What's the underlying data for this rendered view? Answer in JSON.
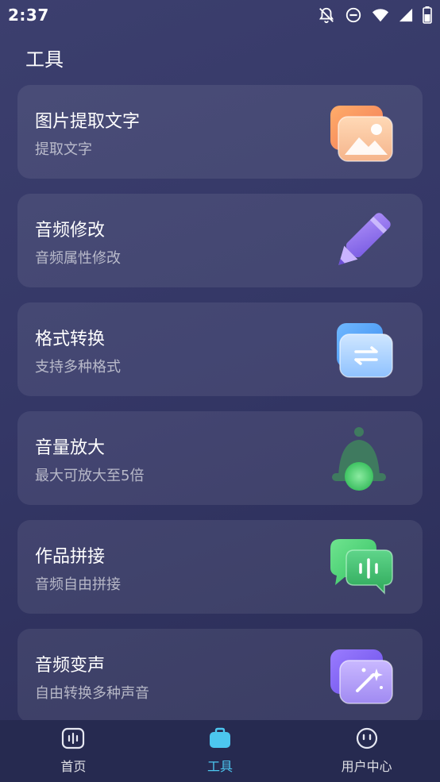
{
  "status_bar": {
    "time": "2:37",
    "icons": [
      "notifications-off-icon",
      "do-not-disturb-icon",
      "wifi-icon",
      "cellular-signal-icon",
      "battery-icon"
    ]
  },
  "page": {
    "title": "工具"
  },
  "tools": [
    {
      "title": "图片提取文字",
      "subtitle": "提取文字",
      "icon": "image-icon"
    },
    {
      "title": "音频修改",
      "subtitle": "音频属性修改",
      "icon": "pen-icon"
    },
    {
      "title": "格式转换",
      "subtitle": "支持多种格式",
      "icon": "swap-icon"
    },
    {
      "title": "音量放大",
      "subtitle": "最大可放大至5倍",
      "icon": "bell-icon"
    },
    {
      "title": "作品拼接",
      "subtitle": "音频自由拼接",
      "icon": "chat-bubbles-icon"
    },
    {
      "title": "音频变声",
      "subtitle": "自由转换多种声音",
      "icon": "magic-wand-icon"
    }
  ],
  "bottom_nav": {
    "items": [
      {
        "label": "首页",
        "icon": "audio-wave-icon",
        "active": false
      },
      {
        "label": "工具",
        "icon": "toolbox-icon",
        "active": true
      },
      {
        "label": "用户中心",
        "icon": "user-face-icon",
        "active": false
      }
    ]
  },
  "colors": {
    "background": "#343766",
    "accent": "#4cc6ef",
    "card": "#48496f"
  }
}
